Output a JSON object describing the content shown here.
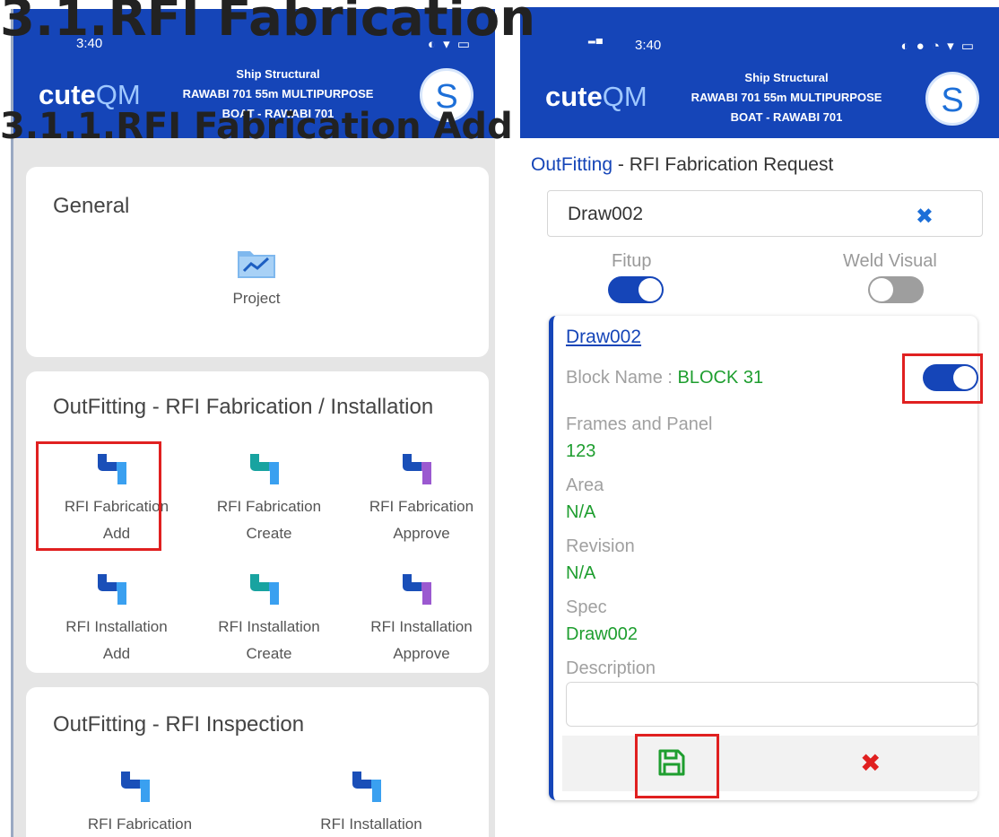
{
  "doc": {
    "heading1": "3.1.RFI Fabrication",
    "heading2": "3.1.1.RFI Fabrication Add"
  },
  "colors": {
    "appbar": "#1545b8",
    "accent_green": "#1e9e2f",
    "highlight_red": "#e02020",
    "clear_blue": "#1d6fd8"
  },
  "left_phone": {
    "status": {
      "time": "3:40"
    },
    "appbar": {
      "brand_bold": "cute",
      "brand_light": "QM",
      "ship_line1": "Ship Structural",
      "ship_line2": "RAWABI 701 55m MULTIPURPOSE",
      "ship_line3": "BOAT - RAWABI 701",
      "avatar_letter": "S"
    },
    "general_card": {
      "title": "General",
      "tiles": [
        {
          "line1": "Project",
          "icon": "chart-folder-icon"
        }
      ]
    },
    "fabrication_card": {
      "title": "OutFitting - RFI Fabrication / Installation",
      "tiles": [
        {
          "line1": "RFI Fabrication",
          "line2": "Add",
          "icon": "pipe-icon"
        },
        {
          "line1": "RFI Fabrication",
          "line2": "Create",
          "icon": "pipe-icon"
        },
        {
          "line1": "RFI Fabrication",
          "line2": "Approve",
          "icon": "pipe-icon"
        },
        {
          "line1": "RFI Installation",
          "line2": "Add",
          "icon": "pipe-icon"
        },
        {
          "line1": "RFI Installation",
          "line2": "Create",
          "icon": "pipe-icon"
        },
        {
          "line1": "RFI Installation",
          "line2": "Approve",
          "icon": "pipe-icon"
        }
      ]
    },
    "inspection_card": {
      "title": "OutFitting - RFI Inspection",
      "tiles": [
        {
          "line1": "RFI Fabrication",
          "icon": "pipe-icon"
        },
        {
          "line1": "RFI Installation",
          "icon": "pipe-icon"
        }
      ]
    }
  },
  "right_phone": {
    "status": {
      "time": "3:40"
    },
    "appbar": {
      "brand_bold": "cute",
      "brand_light": "QM",
      "ship_line1": "Ship Structural",
      "ship_line2": "RAWABI 701 55m MULTIPURPOSE",
      "ship_line3": "BOAT - RAWABI 701",
      "avatar_letter": "S"
    },
    "page_title_prefix": "OutFitting",
    "page_title_suffix": " - RFI Fabrication Request",
    "search": {
      "value": "Draw002",
      "clear_glyph": "✖"
    },
    "toggles": {
      "fitup_label": "Fitup",
      "fitup_on": true,
      "weld_label": "Weld Visual",
      "weld_on": false
    },
    "detail": {
      "link": "Draw002",
      "block_label": "Block Name : ",
      "block_value": "BLOCK 31",
      "block_toggle_on": true,
      "frames_label": "Frames and Panel",
      "frames_value": "123",
      "area_label": "Area",
      "area_value": "N/A",
      "revision_label": "Revision",
      "revision_value": "N/A",
      "spec_label": "Spec",
      "spec_value": "Draw002",
      "description_label": "Description",
      "description_value": ""
    },
    "actions": {
      "save_icon": "save-icon",
      "cancel_glyph": "✖"
    }
  }
}
